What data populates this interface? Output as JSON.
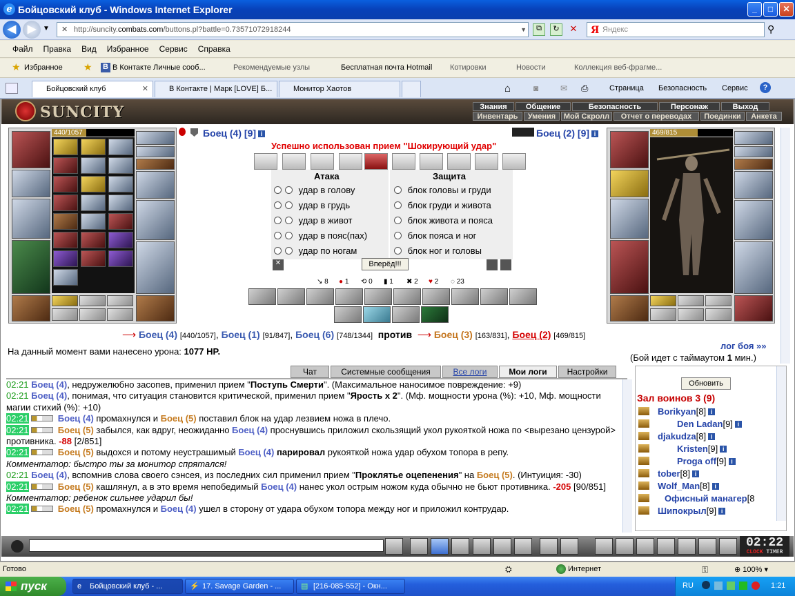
{
  "window": {
    "title": "Бойцовский клуб - Windows Internet Explorer"
  },
  "address": {
    "url_prefix": "http://suncity.",
    "url_domain": "combats.com",
    "url_suffix": "/buttons.pl?battle=0.73571072918244",
    "search_placeholder": "Яндекс"
  },
  "menu": [
    "Файл",
    "Правка",
    "Вид",
    "Избранное",
    "Сервис",
    "Справка"
  ],
  "favorites": {
    "label": "Избранное",
    "items": [
      "В Контакте  Личные сооб...",
      "Рекомендуемые узлы",
      "Бесплатная почта Hotmail",
      "Котировки",
      "Новости",
      "Коллекция веб-фрагме..."
    ]
  },
  "tabs": [
    "Бойцовский клуб",
    "В Контакте | Марк [LOVE] Б...",
    "Монитор Хаотов"
  ],
  "tab_tools": [
    "Страница",
    "Безопасность",
    "Сервис"
  ],
  "game": {
    "logo": "SUNCITY",
    "nav_top": [
      "Знания",
      "Общение",
      "Безопасность",
      "Персонаж",
      "Выход"
    ],
    "nav_bottom": [
      "Инвентарь",
      "Умения",
      "Мой Скролл",
      "Отчет о переводах",
      "Поединки",
      "Анкета"
    ],
    "left_fighter": {
      "name": "Боец (4)",
      "level": "[9]",
      "hp": "440/1057",
      "hp_fraction": 0.416
    },
    "right_fighter": {
      "name": "Боец (2)",
      "level": "[9]",
      "hp": "469/815",
      "hp_fraction": 0.575
    },
    "success_message": "Успешно использован прием \"Шокирующий удар\"",
    "attack_header": "Атака",
    "defense_header": "Защита",
    "attacks": [
      "удар в голову",
      "удар в грудь",
      "удар в живот",
      "удар в пояс(пах)",
      "удар по ногам"
    ],
    "blocks": [
      "блок головы и груди",
      "блок груди и живота",
      "блок живота и пояса",
      "блок пояса и ног",
      "блок ног и головы"
    ],
    "forward_button": "Вперёд!!!",
    "stats": [
      "8",
      "1",
      "0",
      "1",
      "2",
      "2",
      "23"
    ],
    "teams": {
      "t1": [
        {
          "name": "Боец (4)",
          "hp": "[440/1057]"
        },
        {
          "name": "Боец (1)",
          "hp": "[91/847]"
        },
        {
          "name": "Боец (6)",
          "hp": "[748/1344]"
        }
      ],
      "vs": "против",
      "t2": [
        {
          "name": "Боец (3)",
          "hp": "[163/831]"
        },
        {
          "name": "Боец (2)",
          "hp": "[469/815]"
        }
      ]
    },
    "damage_label": "На данный момент вами нанесено урона:",
    "damage_value": "1077 HP.",
    "log_link": "лог боя »»",
    "timeout_pre": "(Бой идет с таймаутом",
    "timeout_val": "1",
    "timeout_post": "мин.)",
    "chat_tabs": [
      "Чат",
      "Системные сообщения",
      "Все логи",
      "Мои логи",
      "Настройки"
    ],
    "users": {
      "refresh": "Обновить",
      "hall": "Зал воинов 3 (9)",
      "list": [
        {
          "name": "Borikyan",
          "lvl": "[8]"
        },
        {
          "name": "Den Ladan",
          "lvl": "[9]"
        },
        {
          "name": "djakudza",
          "lvl": "[8]"
        },
        {
          "name": "Kristen",
          "lvl": "[9]"
        },
        {
          "name": "Proga off",
          "lvl": "[9]"
        },
        {
          "name": "tober",
          "lvl": "[8]"
        },
        {
          "name": "Wolf_Man",
          "lvl": "[8]"
        },
        {
          "name": "Офисный манагер",
          "lvl": "[8"
        },
        {
          "name": "Шипокрыл",
          "lvl": "[9]"
        }
      ]
    },
    "clock": "02:22",
    "clock_labels": [
      "CLOCK",
      "TIMER"
    ]
  },
  "status": {
    "left": "Готово",
    "zone": "Интернет",
    "zoom": "100%"
  },
  "taskbar": {
    "start": "пуск",
    "tasks": [
      "Бойцовский клуб - ...",
      "17. Savage Garden - ...",
      "[216-085-552] - Окн..."
    ],
    "lang": "RU",
    "time": "1:21"
  }
}
